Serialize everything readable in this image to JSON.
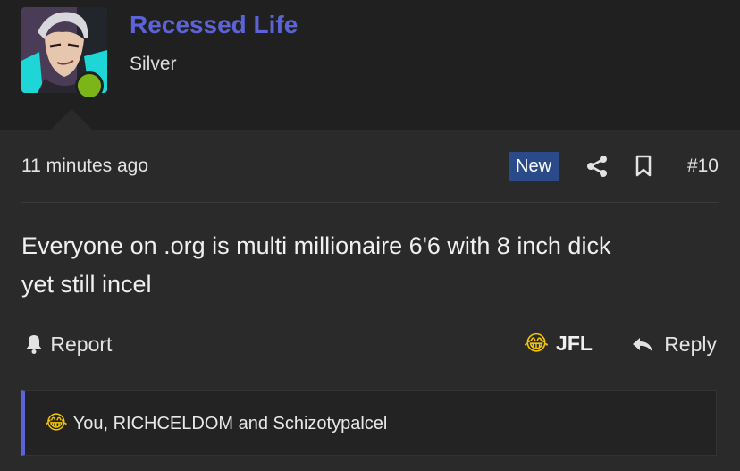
{
  "user": {
    "name": "Recessed Life",
    "rank": "Silver",
    "online": true
  },
  "post": {
    "timestamp": "11 minutes ago",
    "badge": "New",
    "number": "#10",
    "message_line1": "Everyone on .org is multi millionaire 6'6 with 8 inch dick",
    "message_line2": "yet still incel"
  },
  "actions": {
    "report_label": "Report",
    "reaction_emoji": "😂",
    "reaction_label": "JFL",
    "reply_label": "Reply"
  },
  "reactions": {
    "emoji": "😂",
    "text": "You, RICHCELDOM and Schizotypalcel"
  },
  "colors": {
    "username": "#5c63d6",
    "new_badge": "#2b4a8a",
    "online": "#7cb518",
    "reaction_border": "#5c63d6"
  },
  "icons": [
    "share-icon",
    "bookmark-icon",
    "bell-icon",
    "reply-arrow-icon"
  ]
}
